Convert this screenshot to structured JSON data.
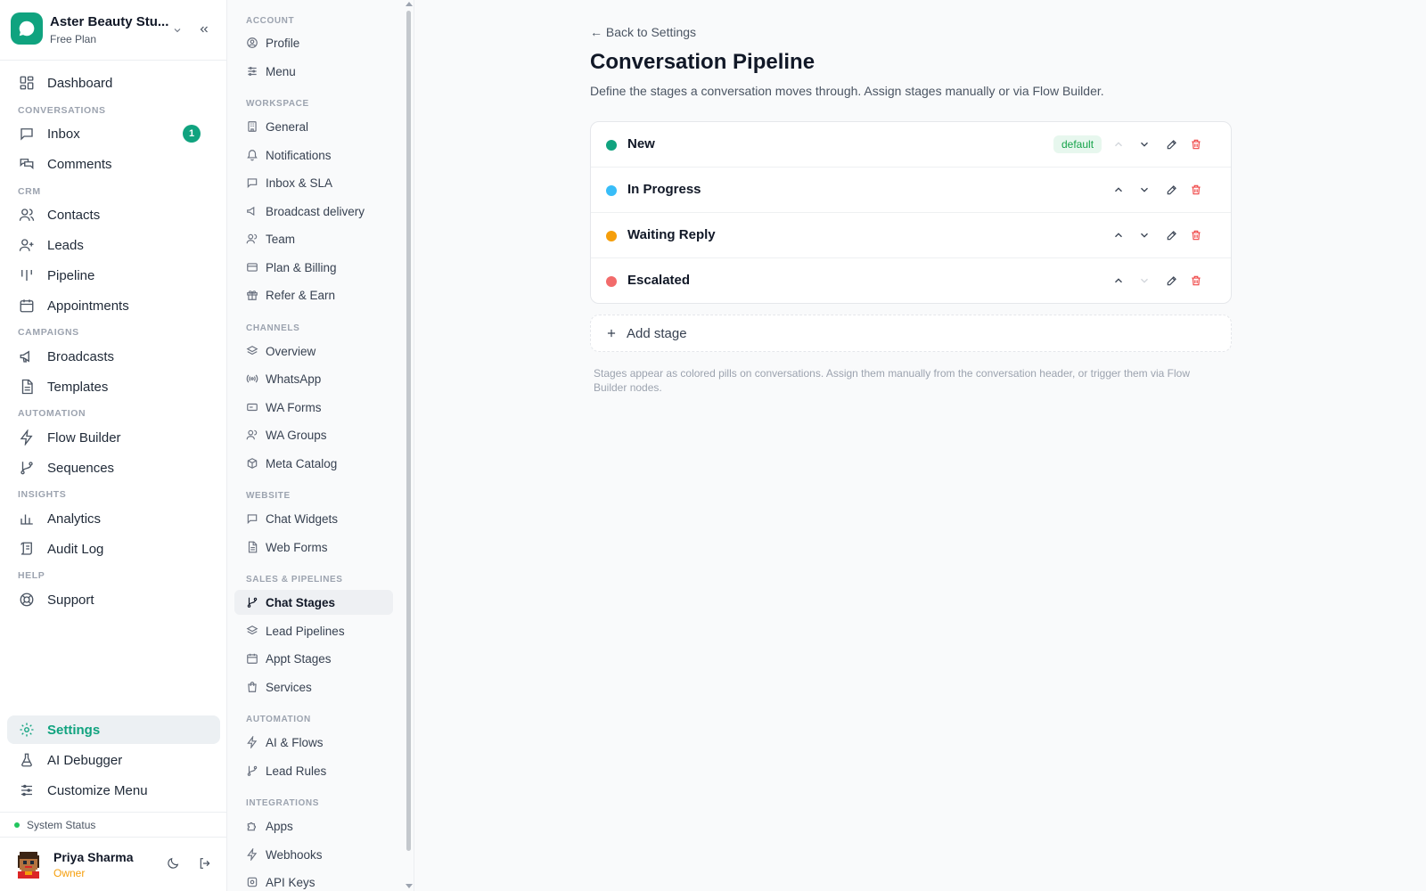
{
  "workspace": {
    "name": "Aster Beauty Stu...",
    "plan": "Free Plan",
    "logo_color": "#10a37f"
  },
  "primary_nav": {
    "dashboard": "Dashboard",
    "sections": {
      "conversations": "CONVERSATIONS",
      "crm": "CRM",
      "campaigns": "CAMPAIGNS",
      "automation": "AUTOMATION",
      "insights": "INSIGHTS",
      "help": "HELP"
    },
    "inbox": "Inbox",
    "inbox_badge": "1",
    "comments": "Comments",
    "contacts": "Contacts",
    "leads": "Leads",
    "pipeline": "Pipeline",
    "appointments": "Appointments",
    "broadcasts": "Broadcasts",
    "templates": "Templates",
    "flow_builder": "Flow Builder",
    "sequences": "Sequences",
    "analytics": "Analytics",
    "audit_log": "Audit Log",
    "support": "Support",
    "settings": "Settings",
    "ai_debugger": "AI Debugger",
    "customize_menu": "Customize Menu"
  },
  "system_status": "System Status",
  "user": {
    "name": "Priya Sharma",
    "role": "Owner"
  },
  "settings_nav": {
    "sections": {
      "account": "ACCOUNT",
      "workspace": "WORKSPACE",
      "channels": "CHANNELS",
      "website": "WEBSITE",
      "sales": "SALES & PIPELINES",
      "automation": "AUTOMATION",
      "integrations": "INTEGRATIONS"
    },
    "profile": "Profile",
    "menu": "Menu",
    "general": "General",
    "notifications": "Notifications",
    "inbox_sla": "Inbox & SLA",
    "broadcast_delivery": "Broadcast delivery",
    "team": "Team",
    "plan_billing": "Plan & Billing",
    "refer_earn": "Refer & Earn",
    "overview": "Overview",
    "whatsapp": "WhatsApp",
    "wa_forms": "WA Forms",
    "wa_groups": "WA Groups",
    "meta_catalog": "Meta Catalog",
    "chat_widgets": "Chat Widgets",
    "web_forms": "Web Forms",
    "chat_stages": "Chat Stages",
    "lead_pipelines": "Lead Pipelines",
    "appt_stages": "Appt Stages",
    "services": "Services",
    "ai_flows": "AI & Flows",
    "lead_rules": "Lead Rules",
    "apps": "Apps",
    "webhooks": "Webhooks",
    "api_keys": "API Keys"
  },
  "main": {
    "back_link": "← Back to Settings",
    "title": "Conversation Pipeline",
    "description": "Define the stages a conversation moves through. Assign stages manually or via Flow Builder.",
    "default_label": "default",
    "stages": [
      {
        "name": "New",
        "color": "#10a37f"
      },
      {
        "name": "In Progress",
        "color": "#38bdf8"
      },
      {
        "name": "Waiting Reply",
        "color": "#f59e0b"
      },
      {
        "name": "Escalated",
        "color": "#f26b6b"
      }
    ],
    "add_stage": "Add stage",
    "help_text": "Stages appear as colored pills on conversations. Assign them manually from the conversation header, or trigger them via Flow Builder nodes."
  }
}
